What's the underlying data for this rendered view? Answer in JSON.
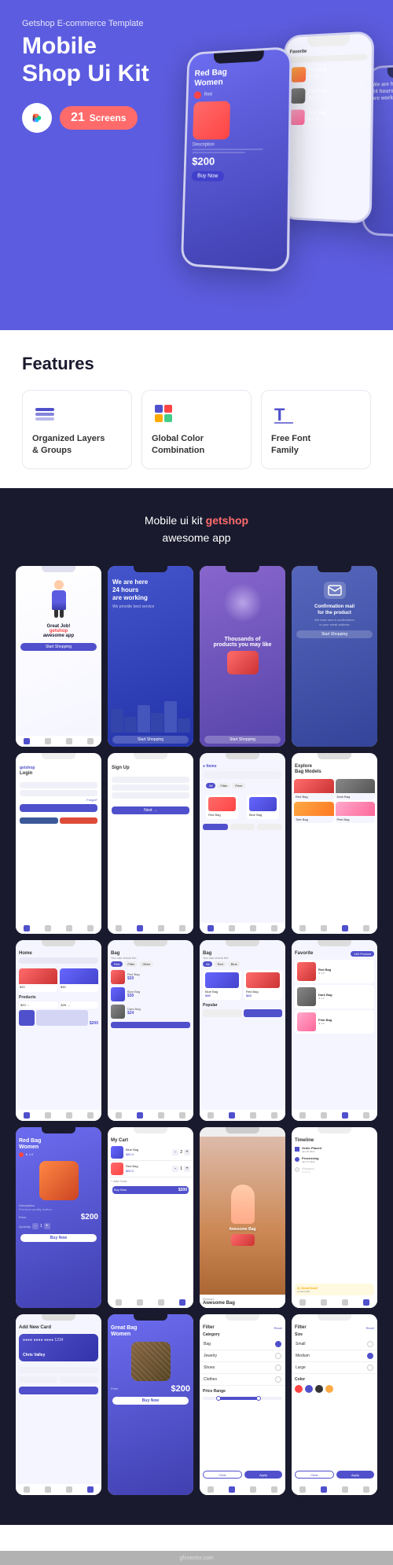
{
  "hero": {
    "subtitle": "Getshop E-commerce Template",
    "title": "Mobile\nShop Ui Kit",
    "figma_icon": "🅕",
    "screens_count": "21",
    "screens_label": "Screens"
  },
  "features": {
    "title": "Features",
    "items": [
      {
        "icon": "layers",
        "label": "Organized Layers\n& Groups"
      },
      {
        "icon": "color",
        "label": "Global Color\nCombination"
      },
      {
        "icon": "font",
        "label": "Free Font\nFamily"
      }
    ]
  },
  "showcase": {
    "title": "Mobile ui kit ",
    "brand": "getshop",
    "subtitle": "awesome app",
    "screens": [
      {
        "id": "onboard1",
        "type": "onboard-person"
      },
      {
        "id": "onboard2",
        "type": "onboard-city"
      },
      {
        "id": "onboard3",
        "type": "onboard-splash"
      },
      {
        "id": "onboard4",
        "type": "onboard-confirm"
      },
      {
        "id": "login",
        "type": "login"
      },
      {
        "id": "signup",
        "type": "signup"
      },
      {
        "id": "products-filter",
        "type": "products-filter"
      },
      {
        "id": "explore",
        "type": "explore"
      },
      {
        "id": "home",
        "type": "home"
      },
      {
        "id": "bag1",
        "type": "bag-list"
      },
      {
        "id": "bag2",
        "type": "bag-list2"
      },
      {
        "id": "favorite",
        "type": "favorite"
      },
      {
        "id": "detail",
        "type": "detail"
      },
      {
        "id": "cart",
        "type": "cart"
      },
      {
        "id": "timeline",
        "type": "timeline"
      },
      {
        "id": "add-card",
        "type": "add-card"
      },
      {
        "id": "detail2",
        "type": "detail2"
      },
      {
        "id": "filter1",
        "type": "filter1"
      },
      {
        "id": "filter2",
        "type": "filter2"
      }
    ]
  },
  "watermark": "gfxvector.com"
}
